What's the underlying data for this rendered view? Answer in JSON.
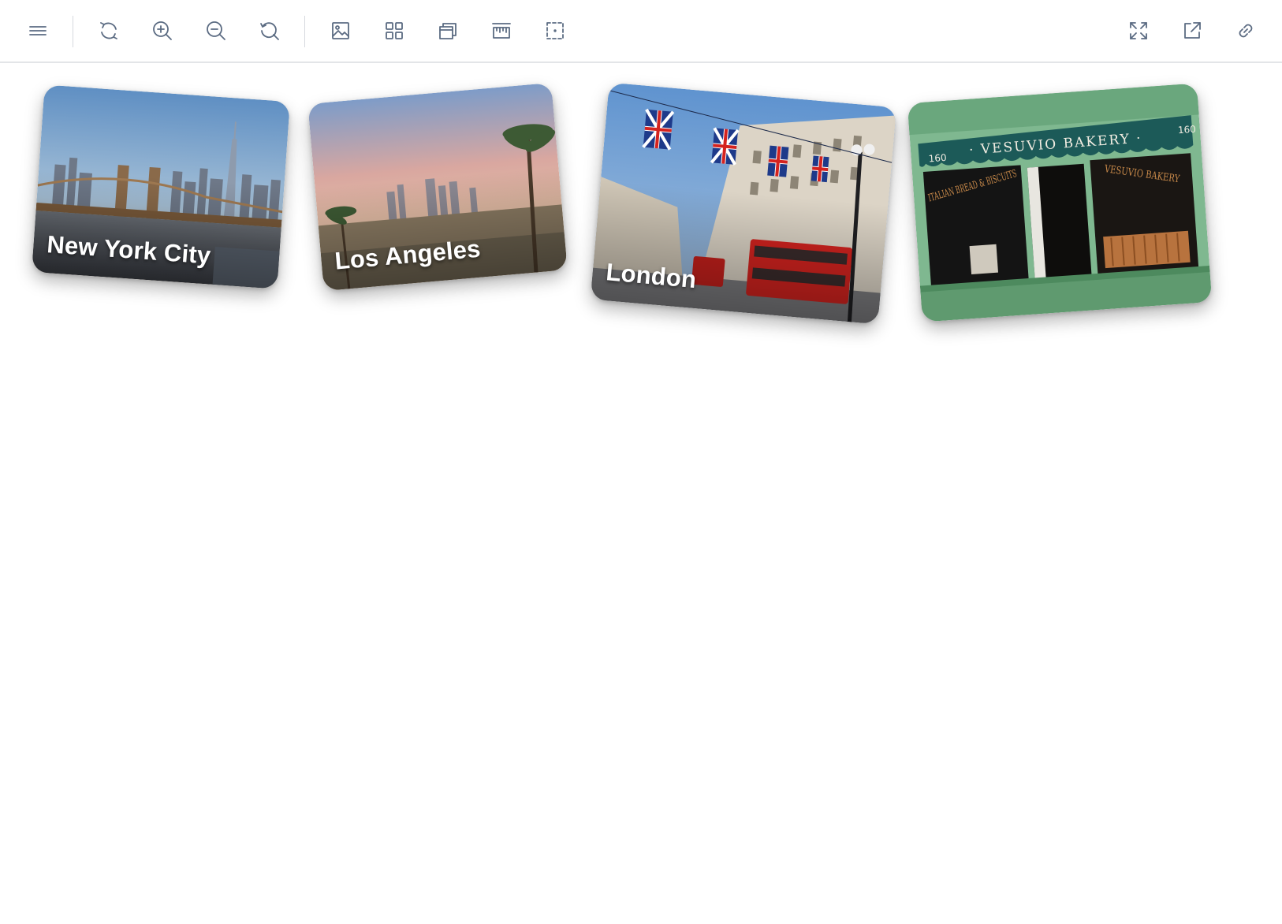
{
  "toolbar": {
    "icons": {
      "menu": "menu-icon",
      "rotate": "rotate-icon",
      "zoom_in": "zoom-in-icon",
      "zoom_out": "zoom-out-icon",
      "reset_zoom": "reset-zoom-icon",
      "image": "image-icon",
      "grid": "grid-icon",
      "layers": "layers-icon",
      "ruler": "ruler-icon",
      "select": "select-area-icon",
      "fullscreen": "fullscreen-icon",
      "open_external": "open-external-icon",
      "link": "link-icon"
    },
    "icon_color": "#5b6b82"
  },
  "cards": [
    {
      "label": "New York City"
    },
    {
      "label": "Los Angeles"
    },
    {
      "label": "London"
    },
    {
      "label": ""
    }
  ],
  "bakery_sign": {
    "awning": "· VESUVIO BAKERY ·",
    "number_left": "160",
    "number_right": "160",
    "window_left": "ITALIAN BREAD & BISCUITS",
    "window_right": "VESUVIO BAKERY"
  }
}
